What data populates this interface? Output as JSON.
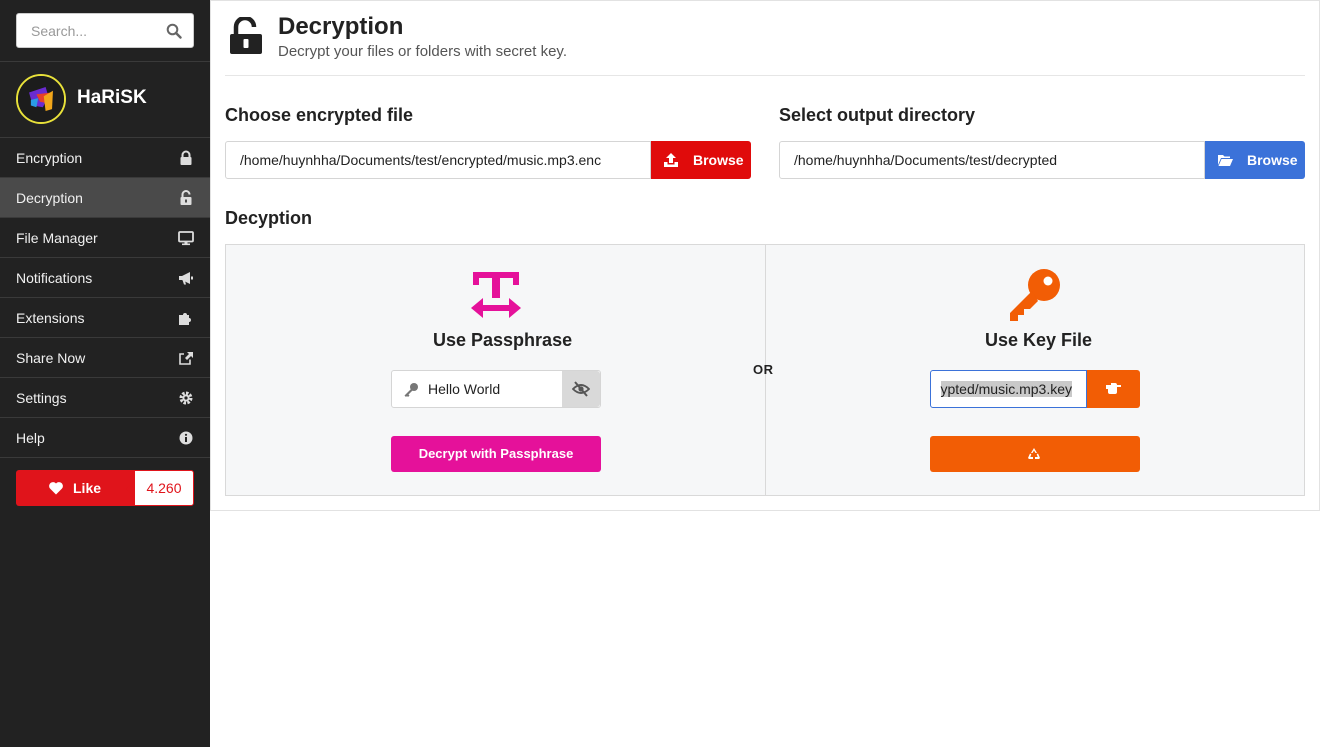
{
  "search": {
    "placeholder": "Search..."
  },
  "profile": {
    "name": "HaRiSK"
  },
  "sidebar": {
    "items": [
      {
        "label": "Encryption",
        "icon": "lock-icon"
      },
      {
        "label": "Decryption",
        "icon": "unlock-icon",
        "active": true
      },
      {
        "label": "File Manager",
        "icon": "monitor-icon"
      },
      {
        "label": "Notifications",
        "icon": "megaphone-icon"
      },
      {
        "label": "Extensions",
        "icon": "puzzle-icon"
      },
      {
        "label": "Share Now",
        "icon": "share-icon"
      },
      {
        "label": "Settings",
        "icon": "gear-icon"
      },
      {
        "label": "Help",
        "icon": "info-icon"
      }
    ]
  },
  "like": {
    "label": "Like",
    "count": "4.260"
  },
  "header": {
    "title": "Decryption",
    "subtitle": "Decrypt your files or folders with secret key."
  },
  "input_file": {
    "label": "Choose encrypted file",
    "value": "/home/huynhha/Documents/test/encrypted/music.mp3.enc",
    "button": "Browse"
  },
  "output_dir": {
    "label": "Select output directory",
    "value": "/home/huynhha/Documents/test/decrypted",
    "button": "Browse"
  },
  "decryption": {
    "title": "Decyption",
    "or_label": "OR",
    "passphrase": {
      "title": "Use Passphrase",
      "value": "Hello World",
      "button": "Decrypt with Passphrase"
    },
    "keyfile": {
      "title": "Use Key File",
      "value": "ypted/music.mp3.key"
    }
  },
  "colors": {
    "sidebar_bg": "#222222",
    "like_red": "#e0141b",
    "browse_red": "#e00b0b",
    "browse_blue": "#3b72d9",
    "passphrase_pink": "#e5119a",
    "keyfile_orange": "#f25d05"
  }
}
